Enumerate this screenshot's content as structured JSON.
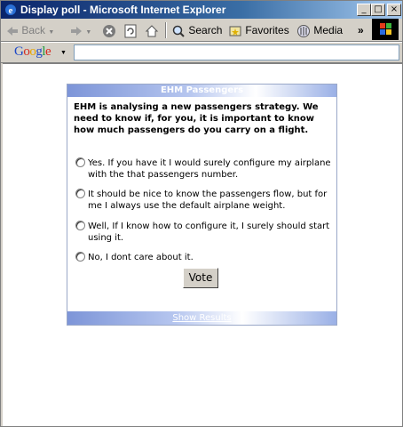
{
  "window": {
    "title": "Display poll - Microsoft Internet Explorer",
    "controls": {
      "minimize": "_",
      "maximize": "□",
      "close": "×"
    }
  },
  "toolbar": {
    "back_label": "Back",
    "search_label": "Search",
    "favorites_label": "Favorites",
    "media_label": "Media",
    "overflow": "»"
  },
  "google_bar": {
    "logo": [
      "G",
      "o",
      "o",
      "g",
      "l",
      "e"
    ],
    "dropdown": "▼",
    "search_value": ""
  },
  "poll": {
    "header": "EHM Passengers",
    "question": "EHM is analysing a new passengers strategy. We need to know if, for you, it is important to know how much passengers do you carry on a flight.",
    "options": [
      "Yes. If you have it I would surely configure my airplane with the that passengers number.",
      "It should be nice to know the passengers flow, but for me I always use the default airplane weight.",
      "Well, If I know how to configure it, I surely should start using it.",
      "No, I dont care about it."
    ],
    "vote_label": "Vote",
    "footer_link": "Show Results"
  },
  "colors": {
    "titlebar_start": "#0a246a",
    "titlebar_end": "#a6caf0",
    "poll_band": "#7d95d8"
  }
}
